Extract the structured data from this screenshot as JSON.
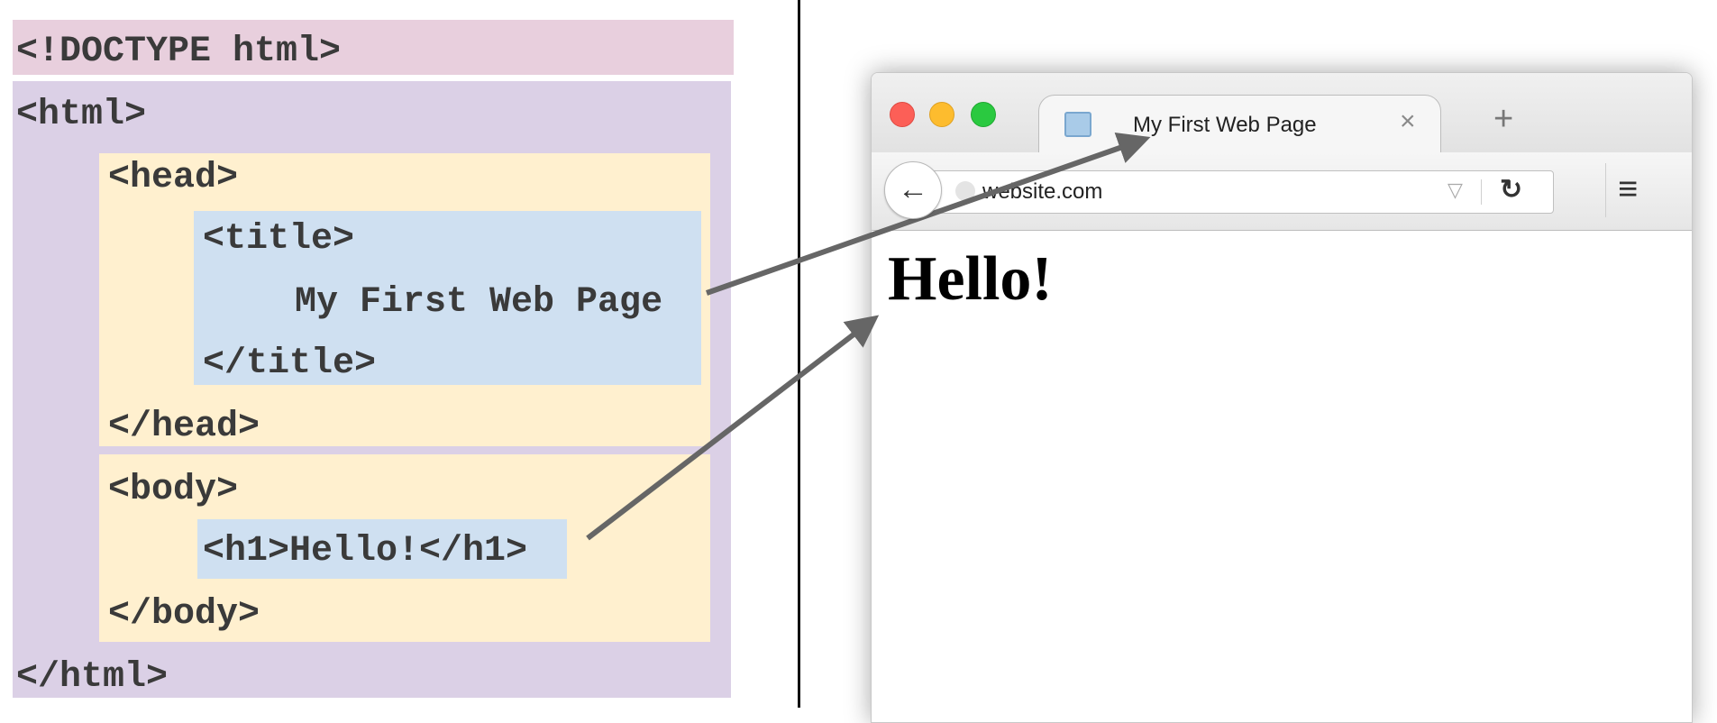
{
  "code": {
    "doctype": "<!DOCTYPE html>",
    "html_open": "<html>",
    "head_open": "<head>",
    "title_open": "<title>",
    "title_text": "My First Web Page",
    "title_close": "</title>",
    "head_close": "</head>",
    "body_open": "<body>",
    "h1_line": "<h1>Hello!</h1>",
    "body_close": "</body>",
    "html_close": "</html>"
  },
  "browser": {
    "tab_title": "My First Web Page",
    "tab_close": "×",
    "new_tab": "+",
    "back": "←",
    "url": "website.com",
    "url_dropdown": "▽",
    "reload": "↻",
    "menu": "≡",
    "heading": "Hello!"
  },
  "colors": {
    "doctype_box": "#e8cfdd",
    "html_box": "#dbd0e6",
    "head_body_box": "#fff0cf",
    "title_h1_box": "#cfe0f1",
    "arrow": "#666666"
  }
}
